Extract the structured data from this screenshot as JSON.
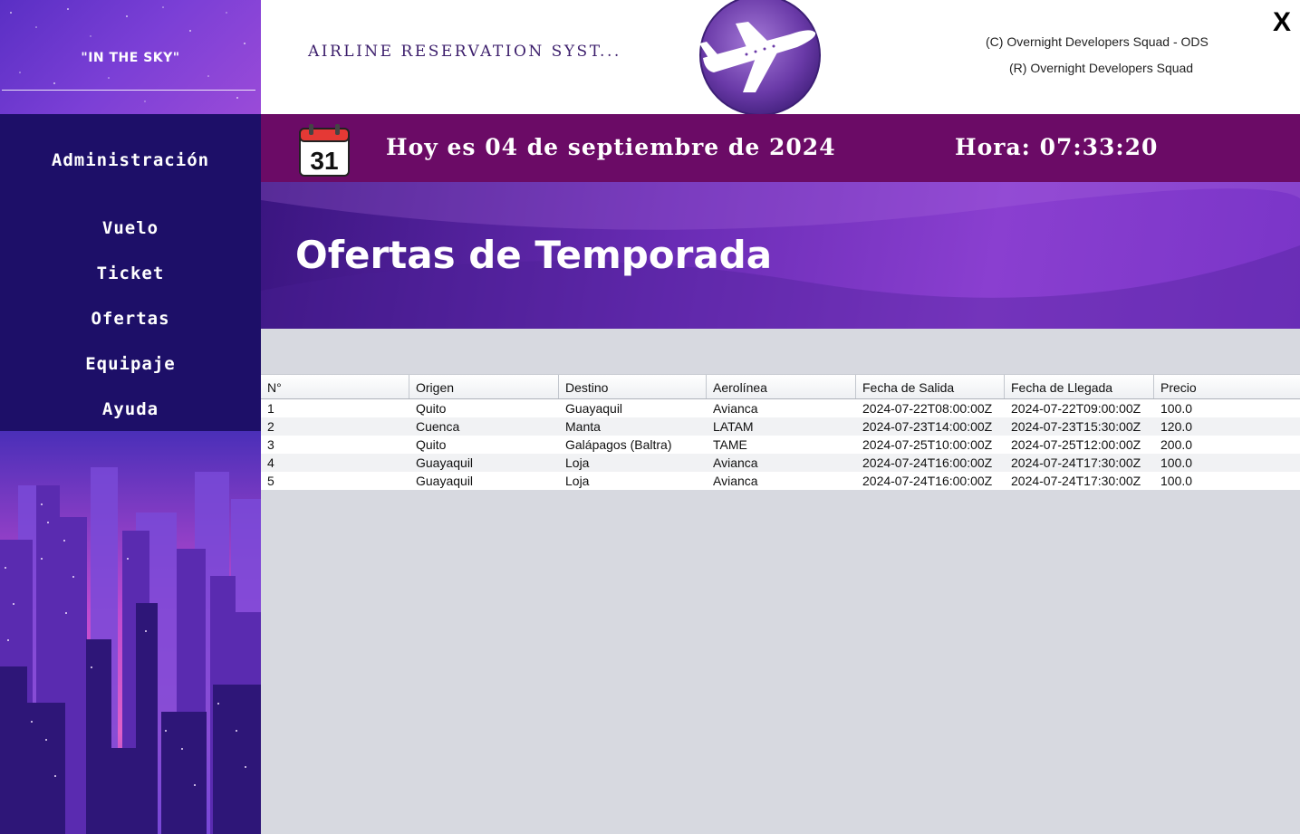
{
  "sidebar": {
    "brand": "\"IN THE SKY\"",
    "items": [
      {
        "label": "Administración"
      },
      {
        "label": "Vuelo"
      },
      {
        "label": "Ticket"
      },
      {
        "label": "Ofertas"
      },
      {
        "label": "Equipaje"
      },
      {
        "label": "Ayuda"
      }
    ]
  },
  "header": {
    "app_title": "AIRLINE RESERVATION SYST...",
    "credit_c": "(C) Overnight Developers Squad - ODS",
    "credit_r": "(R) Overnight Developers Squad",
    "close_label": "X",
    "logo_icon": "airplane-icon"
  },
  "datebar": {
    "calendar_day": "31",
    "date_text": "Hoy es 04 de septiembre de 2024",
    "time_text": "Hora: 07:33:20",
    "icon": "calendar-icon"
  },
  "banner": {
    "title": "Ofertas de Temporada"
  },
  "table": {
    "columns": [
      "N°",
      "Origen",
      "Destino",
      "Aerolínea",
      "Fecha de Salida",
      "Fecha de Llegada",
      "Precio"
    ],
    "rows": [
      [
        "1",
        "Quito",
        "Guayaquil",
        "Avianca",
        "2024-07-22T08:00:00Z",
        "2024-07-22T09:00:00Z",
        "100.0"
      ],
      [
        "2",
        "Cuenca",
        "Manta",
        "LATAM",
        "2024-07-23T14:00:00Z",
        "2024-07-23T15:30:00Z",
        "120.0"
      ],
      [
        "3",
        "Quito",
        "Galápagos (Baltra)",
        "TAME",
        "2024-07-25T10:00:00Z",
        "2024-07-25T12:00:00Z",
        "200.0"
      ],
      [
        "4",
        "Guayaquil",
        "Loja",
        "Avianca",
        "2024-07-24T16:00:00Z",
        "2024-07-24T17:30:00Z",
        "100.0"
      ],
      [
        "5",
        "Guayaquil",
        "Loja",
        "Avianca",
        "2024-07-24T16:00:00Z",
        "2024-07-24T17:30:00Z",
        "100.0"
      ]
    ]
  },
  "colors": {
    "sidebar_nav": "#1d0f68",
    "datebar": "#6b0b66",
    "app_title": "#3b1d6b",
    "content_bg": "#d7d9e0"
  }
}
